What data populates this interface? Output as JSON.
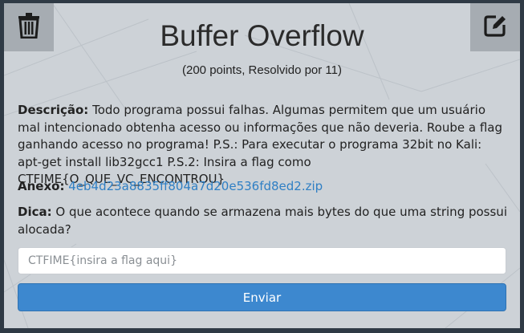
{
  "challenge": {
    "title": "Buffer Overflow",
    "subtitle": "(200 points, Resolvido por 11)",
    "description_label": "Descrição:",
    "description_text": "Todo programa possui falhas. Algumas permitem que um usuário mal intencionado obtenha acesso ou informações que não deveria. Roube a flag ganhando acesso no programa! P.S.: Para executar o programa 32bit no Kali: apt-get install lib32gcc1 P.S.2: Insira a flag como CTFIME{O_QUE_VC_ENCONTROU}",
    "attachment_label": "Anexo:",
    "attachment_link": "4eb4d23a8835ff804a7d20e536fd8ed2.zip",
    "hint_label": "Dica:",
    "hint_text": "O que acontece quando se armazena mais bytes do que uma string possui alocada?"
  },
  "form": {
    "flag_placeholder": "CTFIME{insira a flag aqui}",
    "flag_value": "",
    "submit_label": "Enviar"
  },
  "icons": {
    "delete": "trash-icon",
    "edit": "edit-icon"
  },
  "colors": {
    "card_background": "#cdd2d7",
    "corner_button": "#a6acb2",
    "link": "#2f7fc4",
    "submit_button": "#3d88cf"
  }
}
